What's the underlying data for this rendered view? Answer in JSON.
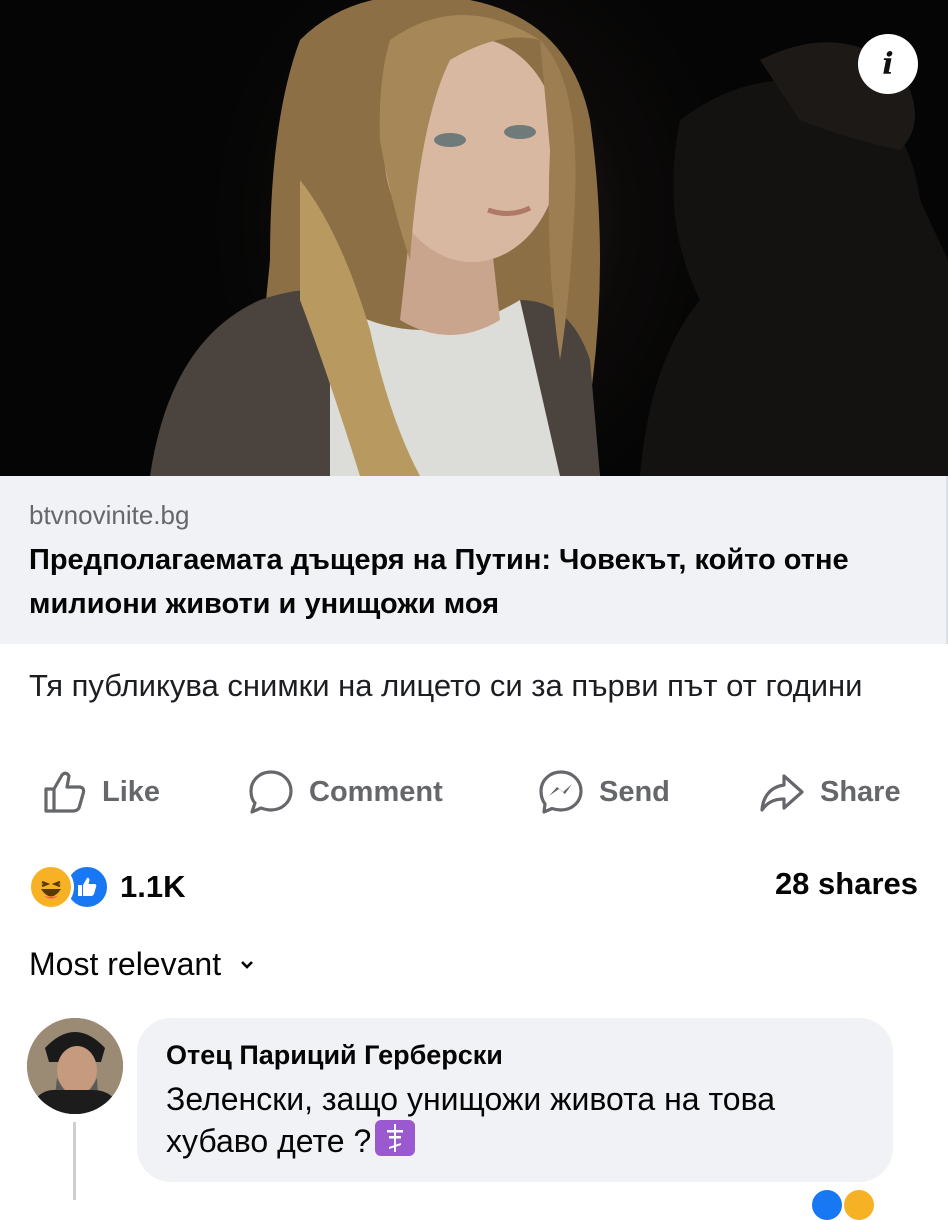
{
  "post": {
    "image_alt": "woman-photo",
    "info_icon_glyph": "i",
    "link_domain": "btvnovinite.bg",
    "link_title": "Предполагаемата дъщеря на Путин: Човекът, който отне милиони животи и унищожи моя",
    "link_subtitle": "Тя публикува снимки на лицето си за първи път от години"
  },
  "actions": {
    "like_label": "Like",
    "comment_label": "Comment",
    "send_label": "Send",
    "share_label": "Share"
  },
  "stats": {
    "reaction_count": "1.1K",
    "shares_text": "28 shares",
    "reaction_icons": [
      "haha-icon",
      "like-icon"
    ],
    "colors": {
      "like_blue": "#1877f2",
      "haha_yellow": "#f7b125",
      "muted": "#65676b"
    }
  },
  "comments": {
    "sort_label": "Most relevant",
    "items": [
      {
        "author": "Отец Париций Герберски",
        "text": "Зеленски, защо унищожи живота на това хубаво дете ?"
      }
    ]
  }
}
